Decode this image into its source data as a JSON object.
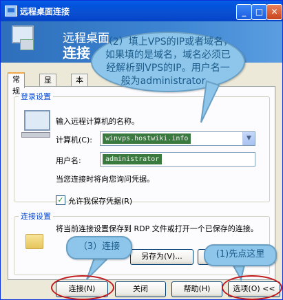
{
  "window": {
    "title": "远程桌面连接",
    "controls": {
      "minimize": "_",
      "maximize": "□",
      "close": "✕"
    }
  },
  "banner": {
    "line1": "远程桌面",
    "line2": "连接"
  },
  "tabs": [
    {
      "label": "常规",
      "active": true
    },
    {
      "label": "显示",
      "active": false
    },
    {
      "label": "本",
      "active": false
    }
  ],
  "login": {
    "legend": "登录设置",
    "instruction": "输入远程计算机的名称。",
    "computer_label": "计算机(C):",
    "computer_value": "winvps.hostwiki.info",
    "username_label": "用户名:",
    "username_value": "administrator",
    "note": "当您连接时将向您询问凭据。",
    "save_credentials_label": "允许我保存凭据(R)",
    "save_credentials_checked": true
  },
  "connection": {
    "legend": "连接设置",
    "description": "将当前连接设置保存到 RDP 文件或打开一个已保存的连接。",
    "save_as_label": "另存为(V)...",
    "open_label": ""
  },
  "buttons": {
    "connect": "连接(N)",
    "close": "关闭",
    "help": "帮助(H)",
    "options": "选项(O) <<"
  },
  "annotations": {
    "main": "（2）填上VPS的IP或者域名，如果填的是域名，域名必须已经解析到VPS的IP。用户名一般为administrator。",
    "step3": "（3）连接",
    "step1": "(1)先点这里"
  },
  "colors": {
    "titlebar": "#0153de",
    "annotation_bubble": "#8dc6ea",
    "annotation_text": "#1b5a8a",
    "highlight_ellipse": "#c0181b",
    "input_highlight": "#3b7a3e"
  }
}
